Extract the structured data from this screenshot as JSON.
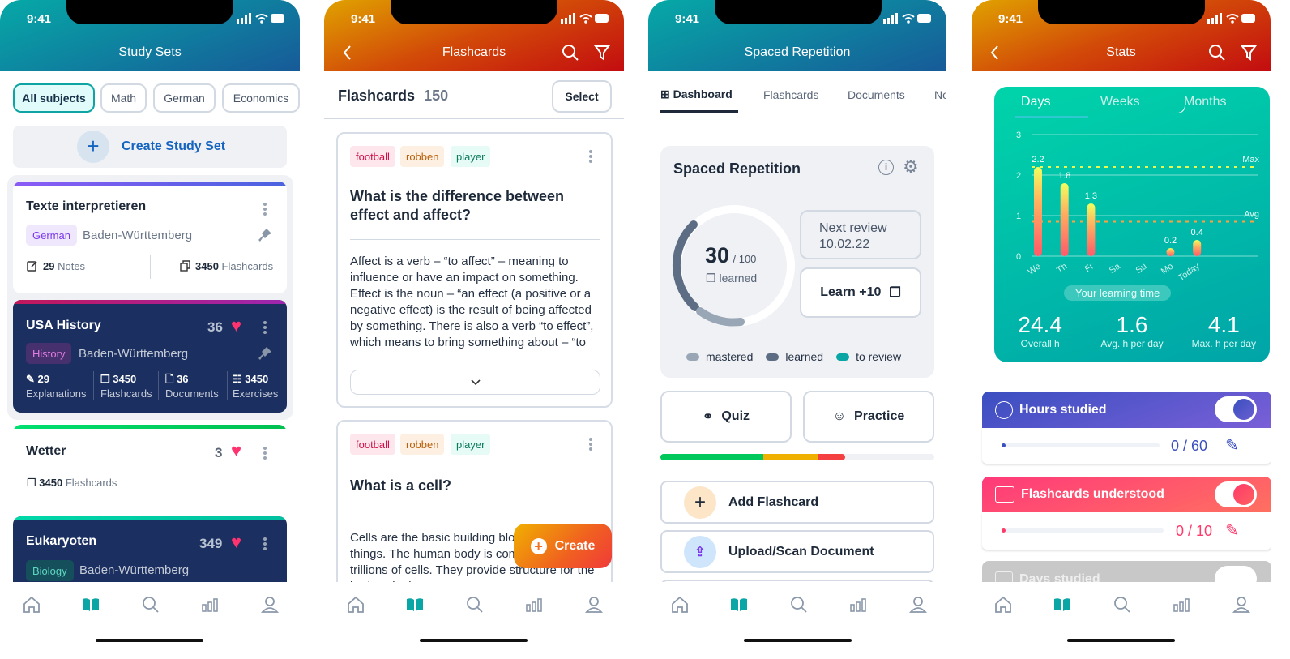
{
  "status_time": "9:41",
  "study_sets": {
    "title": "Study Sets",
    "filters": [
      "All subjects",
      "Math",
      "German",
      "Economics"
    ],
    "create_label": "Create Study Set",
    "sets": [
      {
        "title": "Texte interpretieren",
        "subject": "German",
        "region": "Baden-Württemberg",
        "notes_count": "29",
        "notes_label": "Notes",
        "flashcards_count": "3450",
        "flashcards_label": "Flashcards"
      },
      {
        "title": "USA History",
        "likes": "36",
        "subject": "History",
        "region": "Baden-Württemberg",
        "stats": [
          {
            "count": "29",
            "label": "Explanations"
          },
          {
            "count": "3450",
            "label": "Flashcards"
          },
          {
            "count": "36",
            "label": "Documents"
          },
          {
            "count": "3450",
            "label": "Exercises"
          }
        ]
      },
      {
        "title": "Wetter",
        "likes": "3",
        "flashcards_count": "3450",
        "flashcards_label": "Flashcards"
      },
      {
        "title": "Eukaryoten",
        "likes": "349",
        "subject": "Biology",
        "region": "Baden-Württemberg"
      }
    ]
  },
  "flashcards": {
    "title": "Flashcards",
    "heading": "Flashcards",
    "count": "150",
    "select_label": "Select",
    "cards": [
      {
        "tags": [
          "football",
          "robben",
          "player"
        ],
        "question": "What is the difference between effect and affect?",
        "answer": "Affect is a verb – “to affect” – meaning to influence or have an impact on something. Effect is the noun – “an effect (a positive or a negative effect) is the result of being affected by something. There is also a verb “to effect”, which means to bring something about – “to"
      },
      {
        "tags": [
          "football",
          "robben",
          "player"
        ],
        "question": "What is a cell?",
        "answer": "Cells are the basic building blocks of all living things. The human body is composed of trillions of cells. They provide structure for the body, take in"
      }
    ],
    "create_label": "Create"
  },
  "spaced": {
    "title": "Spaced Repetition",
    "tabs": [
      "Dashboard",
      "Flashcards",
      "Documents",
      "Notes"
    ],
    "card_title": "Spaced Repetition",
    "learned": "30",
    "total": "/ 100",
    "learned_label": "learned",
    "next_review_label": "Next review",
    "next_review_date": "10.02.22",
    "learn_label": "Learn +10",
    "legend": [
      "mastered",
      "learned",
      "to review"
    ],
    "quiz_label": "Quiz",
    "practice_label": "Practice",
    "progress_pct": {
      "green": 37.5,
      "yellow": 20,
      "red": 10
    },
    "add_flashcard_label": "Add Flashcard",
    "upload_label": "Upload/Scan Document"
  },
  "stats": {
    "title": "Stats",
    "tabs": [
      "Days",
      "Weeks",
      "Months"
    ],
    "y_ticks": [
      "0",
      "1",
      "2",
      "3"
    ],
    "max_label": "Max",
    "avg_label": "Avg",
    "caption": "Your learning time",
    "summary": [
      {
        "value": "24.4",
        "label": "Overall h"
      },
      {
        "value": "1.6",
        "label": "Avg. h per day"
      },
      {
        "value": "4.1",
        "label": "Max. h per day"
      }
    ],
    "goals": [
      {
        "label": "Hours studied",
        "progress": "0 / 60",
        "color": "#3a4fc0"
      },
      {
        "label": "Flashcards understood",
        "progress": "0 / 10",
        "color": "#ff3a6a"
      },
      {
        "label": "Days studied"
      }
    ]
  },
  "chart_data": {
    "type": "bar",
    "categories": [
      "We",
      "Th",
      "Fr",
      "Sa",
      "Su",
      "Mo",
      "Today"
    ],
    "values": [
      2.2,
      1.8,
      1.3,
      0,
      0,
      0.2,
      0.4
    ],
    "value_labels": [
      "2.2",
      "1.8",
      "1.3",
      "",
      "",
      "0.2",
      "0.4"
    ],
    "ylim": [
      0,
      3
    ],
    "max_line": 2.2,
    "avg_line": 0.85
  },
  "colors": {
    "teal": "#0aa5a5",
    "navy": "#1b2f60",
    "heart": "#ff3370",
    "link_blue": "#1565c0"
  }
}
